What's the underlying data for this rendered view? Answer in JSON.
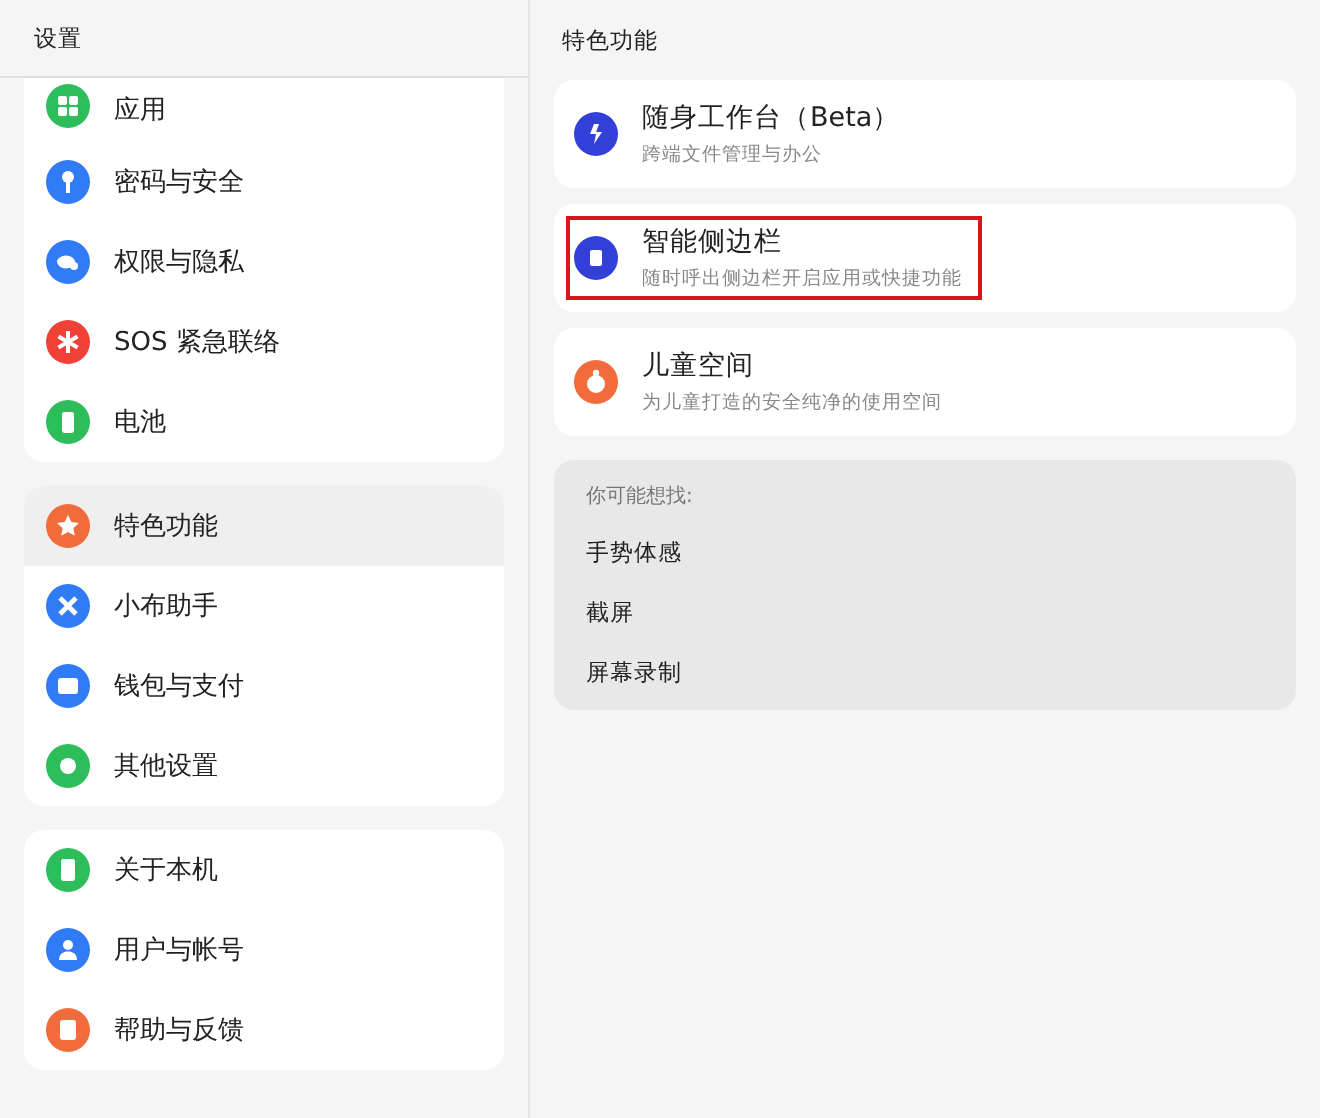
{
  "sidebar": {
    "title": "设置",
    "groups": [
      {
        "items": [
          {
            "label": "应用",
            "color": "#2dbd5a",
            "selected": false
          },
          {
            "label": "密码与安全",
            "color": "#2f7cf6",
            "selected": false
          },
          {
            "label": "权限与隐私",
            "color": "#2f7cf6",
            "selected": false
          },
          {
            "label": "SOS 紧急联络",
            "color": "#ef4136",
            "selected": false
          },
          {
            "label": "电池",
            "color": "#2dbd5a",
            "selected": false
          }
        ]
      },
      {
        "items": [
          {
            "label": "特色功能",
            "color": "#f26b3a",
            "selected": true
          },
          {
            "label": "小布助手",
            "color": "#2f7cf6",
            "selected": false
          },
          {
            "label": "钱包与支付",
            "color": "#2f7cf6",
            "selected": false
          },
          {
            "label": "其他设置",
            "color": "#2dbd5a",
            "selected": false
          }
        ]
      },
      {
        "items": [
          {
            "label": "关于本机",
            "color": "#2dbd5a",
            "selected": false
          },
          {
            "label": "用户与帐号",
            "color": "#2f7cf6",
            "selected": false
          },
          {
            "label": "帮助与反馈",
            "color": "#f26b3a",
            "selected": false
          }
        ]
      }
    ]
  },
  "content": {
    "title": "特色功能",
    "features": [
      {
        "title": "随身工作台（Beta）",
        "subtitle": "跨端文件管理与办公",
        "color": "#3340d8",
        "highlighted": false
      },
      {
        "title": "智能侧边栏",
        "subtitle": "随时呼出侧边栏开启应用或快捷功能",
        "color": "#3340d8",
        "highlighted": true
      },
      {
        "title": "儿童空间",
        "subtitle": "为儿童打造的安全纯净的使用空间",
        "color": "#f26b3a",
        "highlighted": false
      }
    ],
    "suggestions": {
      "heading": "你可能想找:",
      "items": [
        "手势体感",
        "截屏",
        "屏幕录制"
      ]
    }
  }
}
